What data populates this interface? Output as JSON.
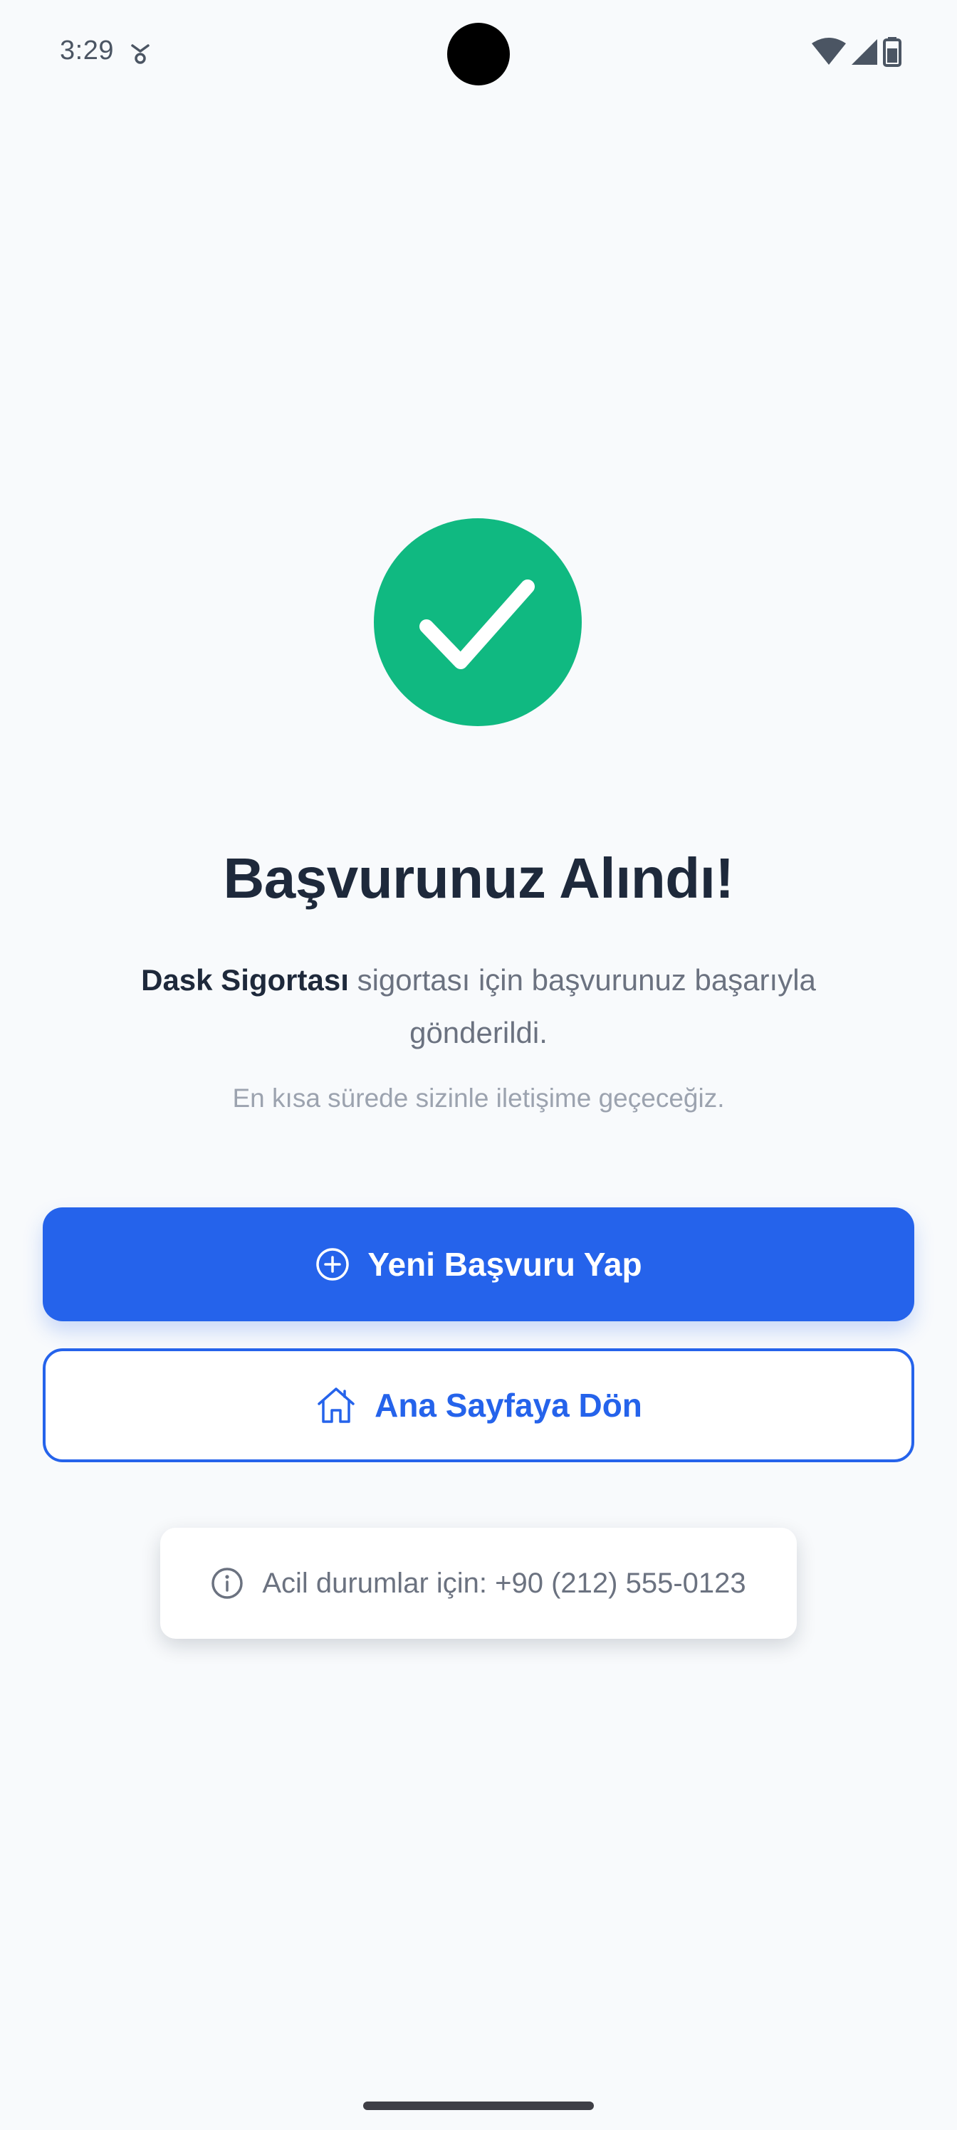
{
  "status_bar": {
    "time": "3:29"
  },
  "success": {
    "title": "Başvurunuz Alındı!",
    "product_name": "Dask Sigortası",
    "message_rest": " sigortası için başvurunuz başarıyla gönderildi.",
    "subtitle": "En kısa sürede sizinle iletişime geçeceğiz."
  },
  "actions": {
    "new_application_label": "Yeni Başvuru Yap",
    "home_label": "Ana Sayfaya Dön"
  },
  "info": {
    "emergency_text": "Acil durumlar için: +90 (212) 555-0123"
  },
  "colors": {
    "success": "#10b981",
    "primary": "#2563eb",
    "background": "#f8fafc",
    "title": "#1e293b"
  },
  "icons": {
    "success": "check-icon",
    "new_application": "plus-circle-icon",
    "home": "home-icon",
    "info": "info-icon"
  }
}
